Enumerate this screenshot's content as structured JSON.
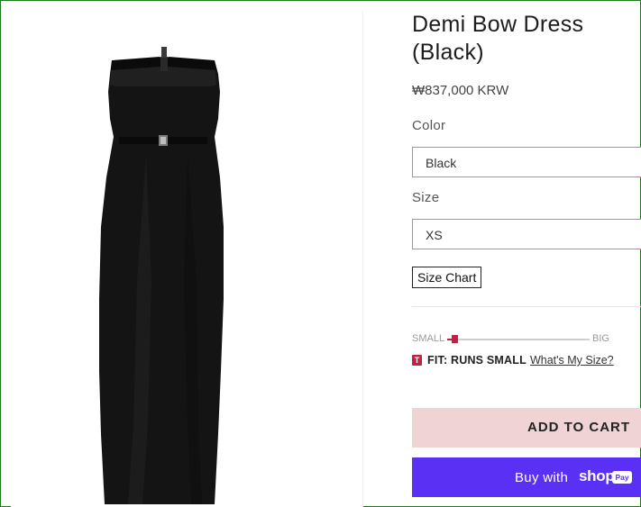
{
  "product": {
    "title": "Demi Bow Dress (Black)",
    "price": "₩837,000 KRW",
    "image": {
      "description_icon": "dress-photo"
    }
  },
  "color": {
    "label": "Color",
    "selected": "Black"
  },
  "size": {
    "label": "Size",
    "selected": "XS"
  },
  "size_chart": {
    "label": "Size Chart"
  },
  "fit": {
    "small_label": "SMALL",
    "big_label": "BIG",
    "level_fraction": 0.05,
    "badge": "T",
    "text": "FIT: RUNS SMALL",
    "link": "What's My Size?"
  },
  "cart": {
    "add_label": "ADD TO CART"
  },
  "shop_pay": {
    "buy_with": "Buy with",
    "shop": "shop",
    "pay": "Pay",
    "color": "#5a31f4"
  },
  "colors": {
    "accent": "#c3213f",
    "add_to_cart_bg": "#f0d3d4"
  }
}
